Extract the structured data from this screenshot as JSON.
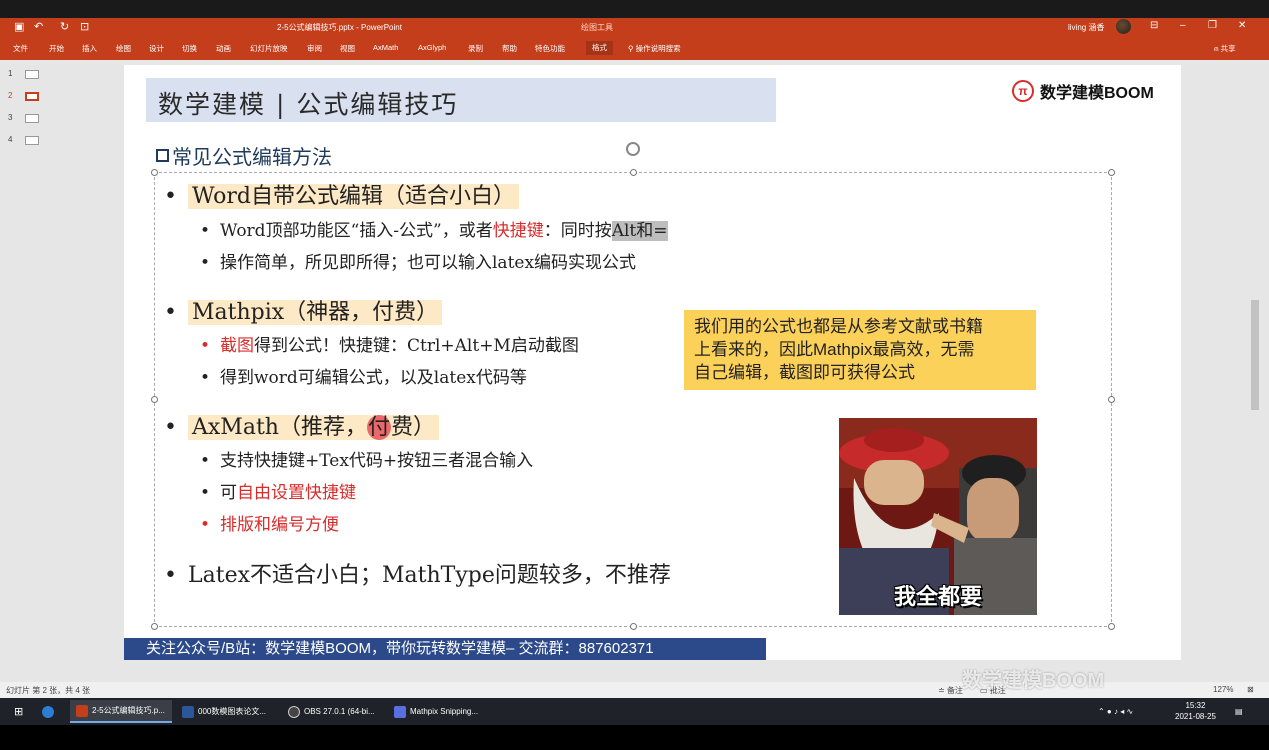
{
  "window": {
    "doc_title": "2-5公式编辑技巧.pptx - PowerPoint",
    "context_tab": "绘图工具",
    "user": "living 涵香"
  },
  "ribbon": {
    "tabs": [
      "文件",
      "开始",
      "插入",
      "绘图",
      "设计",
      "切换",
      "动画",
      "幻灯片放映",
      "审阅",
      "视图",
      "AxMath",
      "AxGlyph",
      "录制",
      "帮助",
      "特色功能",
      "格式"
    ],
    "active_tab": "格式",
    "search_hint": "操作说明搜索",
    "share": "共享"
  },
  "thumbnails": [
    "1",
    "2",
    "3",
    "4"
  ],
  "slide": {
    "title": "数学建模 | 公式编辑技巧",
    "brand_logo": "π",
    "brand": "数学建模BOOM",
    "section_heading": "常见公式编辑方法",
    "bullets": {
      "b1": "Word自带公式编辑（适合小白）",
      "b1_sub1_a": "Word顶部功能区“插入-公式”，或者",
      "b1_sub1_red": "快捷键",
      "b1_sub1_b": "：同时按",
      "b1_sub1_gray": "Alt和=",
      "b1_sub2": "操作简单，所见即所得；也可以输入latex编码实现公式",
      "b2": "Mathpix（神器，付费）",
      "b2_sub1_red": "截图",
      "b2_sub1_b": "得到公式！快捷键：Ctrl+Alt+M启动截图",
      "b2_sub2": "得到word可编辑公式，以及latex代码等",
      "b3_a": "AxMath（推荐，",
      "b3_circ": "付",
      "b3_b": "费）",
      "b3_sub1": "支持快捷键+Tex代码+按钮三者混合输入",
      "b3_sub2_a": "可",
      "b3_sub2_red": "自由设置快捷键",
      "b3_sub3_red": "排版和编号方便",
      "b4": "Latex不适合小白；MathType问题较多，不推荐"
    },
    "callout": [
      "我们用的公式也都是从参考文献或书籍",
      "上看来的，因此Mathpix最高效，无需",
      "自己编辑，截图即可获得公式"
    ],
    "meme_caption": "我全都要",
    "footer": "关注公众号/B站：数学建模BOOM，带你玩转数学建模– 交流群：887602371"
  },
  "statusbar": {
    "slide_count": "幻灯片 第 2 张，共 4 张",
    "notes": "备注",
    "comments": "批注",
    "zoom": "127%",
    "watermark": "数学建模BOOM"
  },
  "taskbar": {
    "apps": [
      "2-5公式编辑技巧.p...",
      "000数模图表论文...",
      "OBS 27.0.1 (64-bi...",
      "Mathpix Snipping..."
    ],
    "time": "15:32",
    "date": "2021-08-25"
  }
}
